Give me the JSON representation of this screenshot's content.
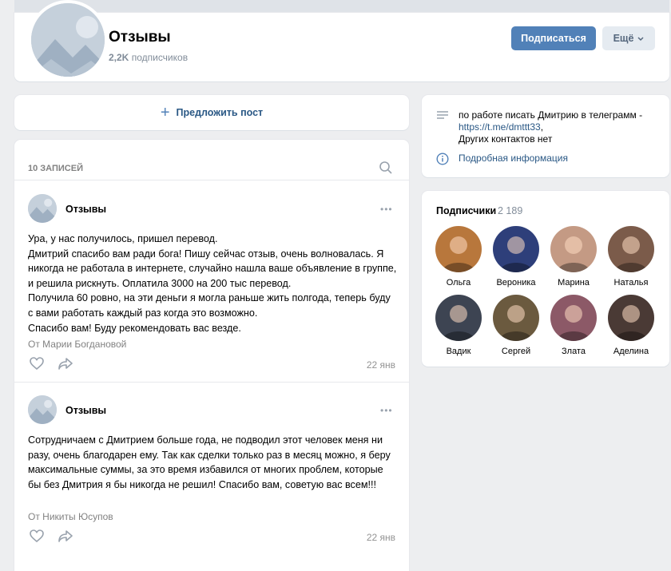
{
  "header": {
    "title": "Отзывы",
    "subscribers_count": "2,2K",
    "subscribers_label": "подписчиков",
    "subscribe_label": "Подписаться",
    "more_label": "Ещё"
  },
  "suggest": {
    "label": "Предложить пост"
  },
  "feed": {
    "count_label": "10 записей",
    "posts": [
      {
        "author": "Отзывы",
        "text": "Ура, у нас получилось, пришел перевод.\nДмитрий спасибо вам ради бога! Пишу сейчас отзыв, очень волновалась. Я никогда не работала в интернете, случайно нашла ваше объявление в группе, и решила рискнуть. Оплатила 3000 на 200 тыс перевод.\nПолучила 60 ровно, на эти деньги я могла раньше жить полгода, теперь буду с вами работать каждый раз когда это возможно.\nСпасибо вам! Буду рекомендовать вас везде.",
        "from": "От Марии Богдановой",
        "date": "22 янв"
      },
      {
        "author": "Отзывы",
        "text": "Сотрудничаем с Дмитрием больше года, не подводил этот человек меня ни разу, очень благодарен ему. Так как сделки только раз в месяц можно, я беру максимальные суммы, за это время избавился от многих проблем, которые бы без Дмитрия я бы никогда не решил! Спасибо вам, советую вас всем!!!",
        "from": "От Никиты Юсупов",
        "date": "22 янв"
      }
    ]
  },
  "info": {
    "description_line1": "по работе писать Дмитрию в телеграмм -",
    "description_link": "https://t.me/dmttt33",
    "description_comma": ",",
    "description_line3": "Других контактов нет",
    "details_label": "Подробная информация"
  },
  "subscribers": {
    "title": "Подписчики",
    "count": "2 189",
    "people": [
      {
        "name": "Ольга",
        "color": "#b8773c"
      },
      {
        "name": "Вероника",
        "color": "#2e3f7a"
      },
      {
        "name": "Марина",
        "color": "#c49a84"
      },
      {
        "name": "Наталья",
        "color": "#7b5b4a"
      },
      {
        "name": "Вадик",
        "color": "#3d4452"
      },
      {
        "name": "Сергей",
        "color": "#6b5a3f"
      },
      {
        "name": "Злата",
        "color": "#8c5967"
      },
      {
        "name": "Аделина",
        "color": "#4a3a35"
      }
    ]
  },
  "colors": {
    "accent": "#5181b8",
    "link": "#2a5885",
    "background": "#edeef0"
  }
}
